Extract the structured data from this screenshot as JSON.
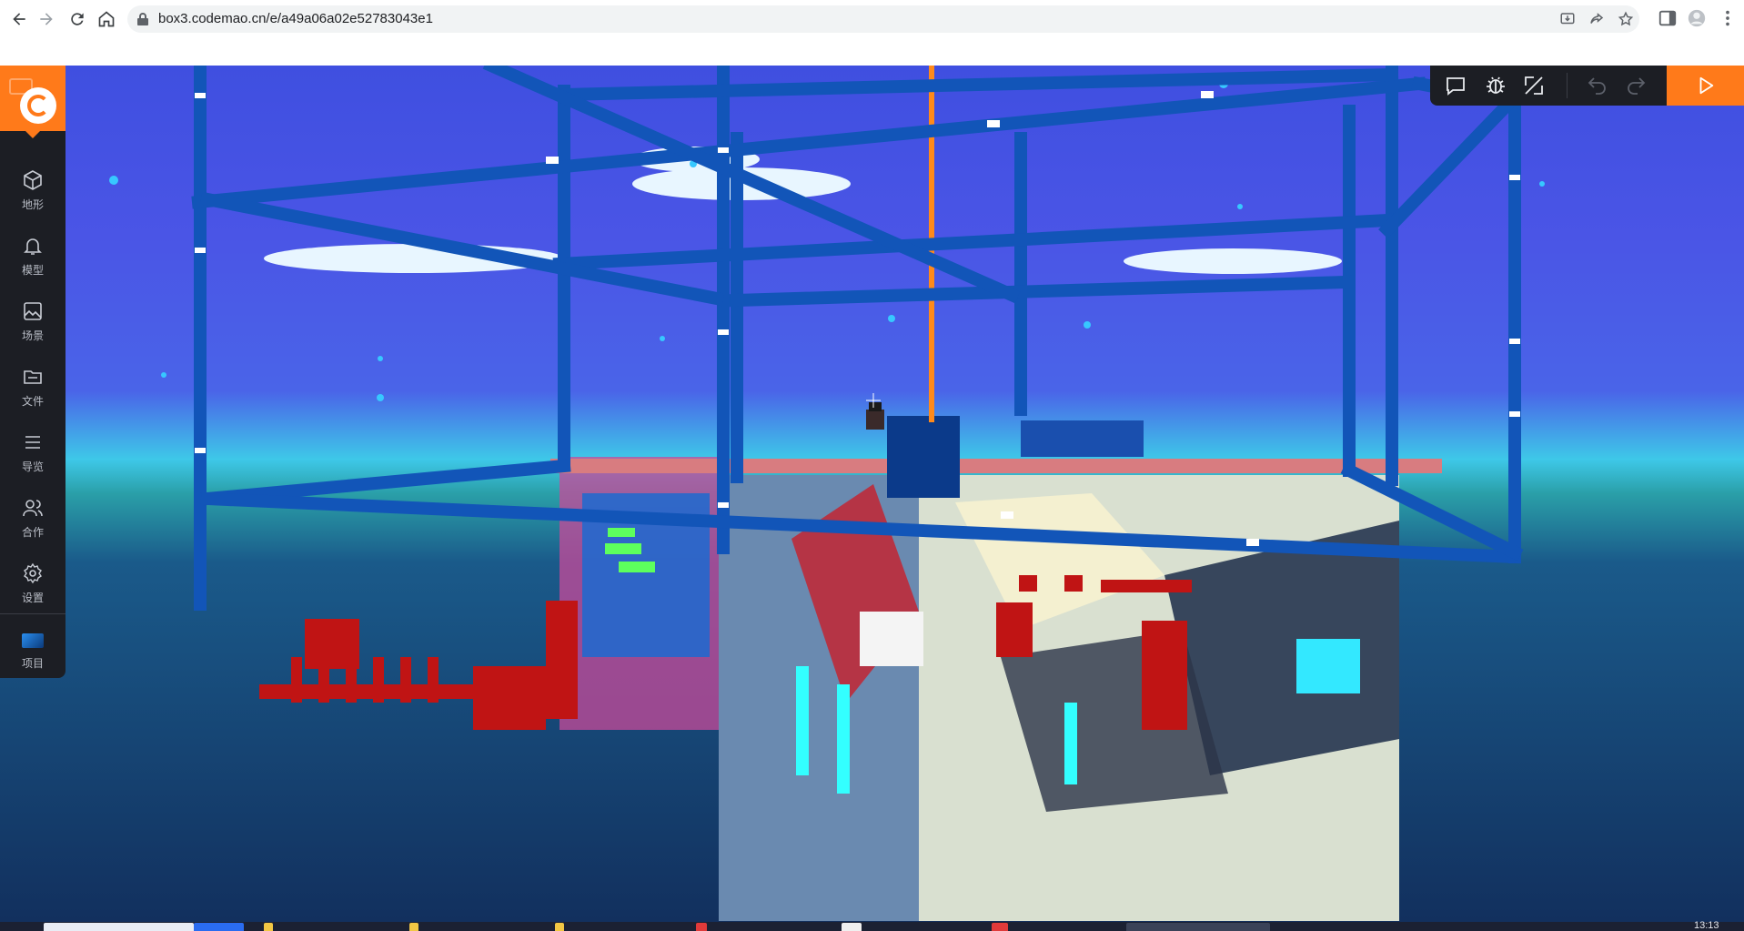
{
  "browser": {
    "url": "box3.codemao.cn/e/a49a06a02e52783043e1"
  },
  "sidebar": {
    "items": [
      {
        "label": "地形",
        "icon": "cube-icon"
      },
      {
        "label": "模型",
        "icon": "bell-icon"
      },
      {
        "label": "场景",
        "icon": "image-icon"
      },
      {
        "label": "文件",
        "icon": "folder-icon"
      },
      {
        "label": "导览",
        "icon": "list-icon"
      },
      {
        "label": "合作",
        "icon": "users-icon"
      },
      {
        "label": "设置",
        "icon": "gear-icon"
      },
      {
        "label": "项目",
        "icon": "project-icon"
      }
    ]
  },
  "toolbar": {
    "icons": [
      "comment-icon",
      "debug-icon",
      "fullscreen-icon",
      "undo-icon",
      "redo-icon",
      "play-icon"
    ]
  },
  "taskbar": {
    "clock": "13:13"
  }
}
